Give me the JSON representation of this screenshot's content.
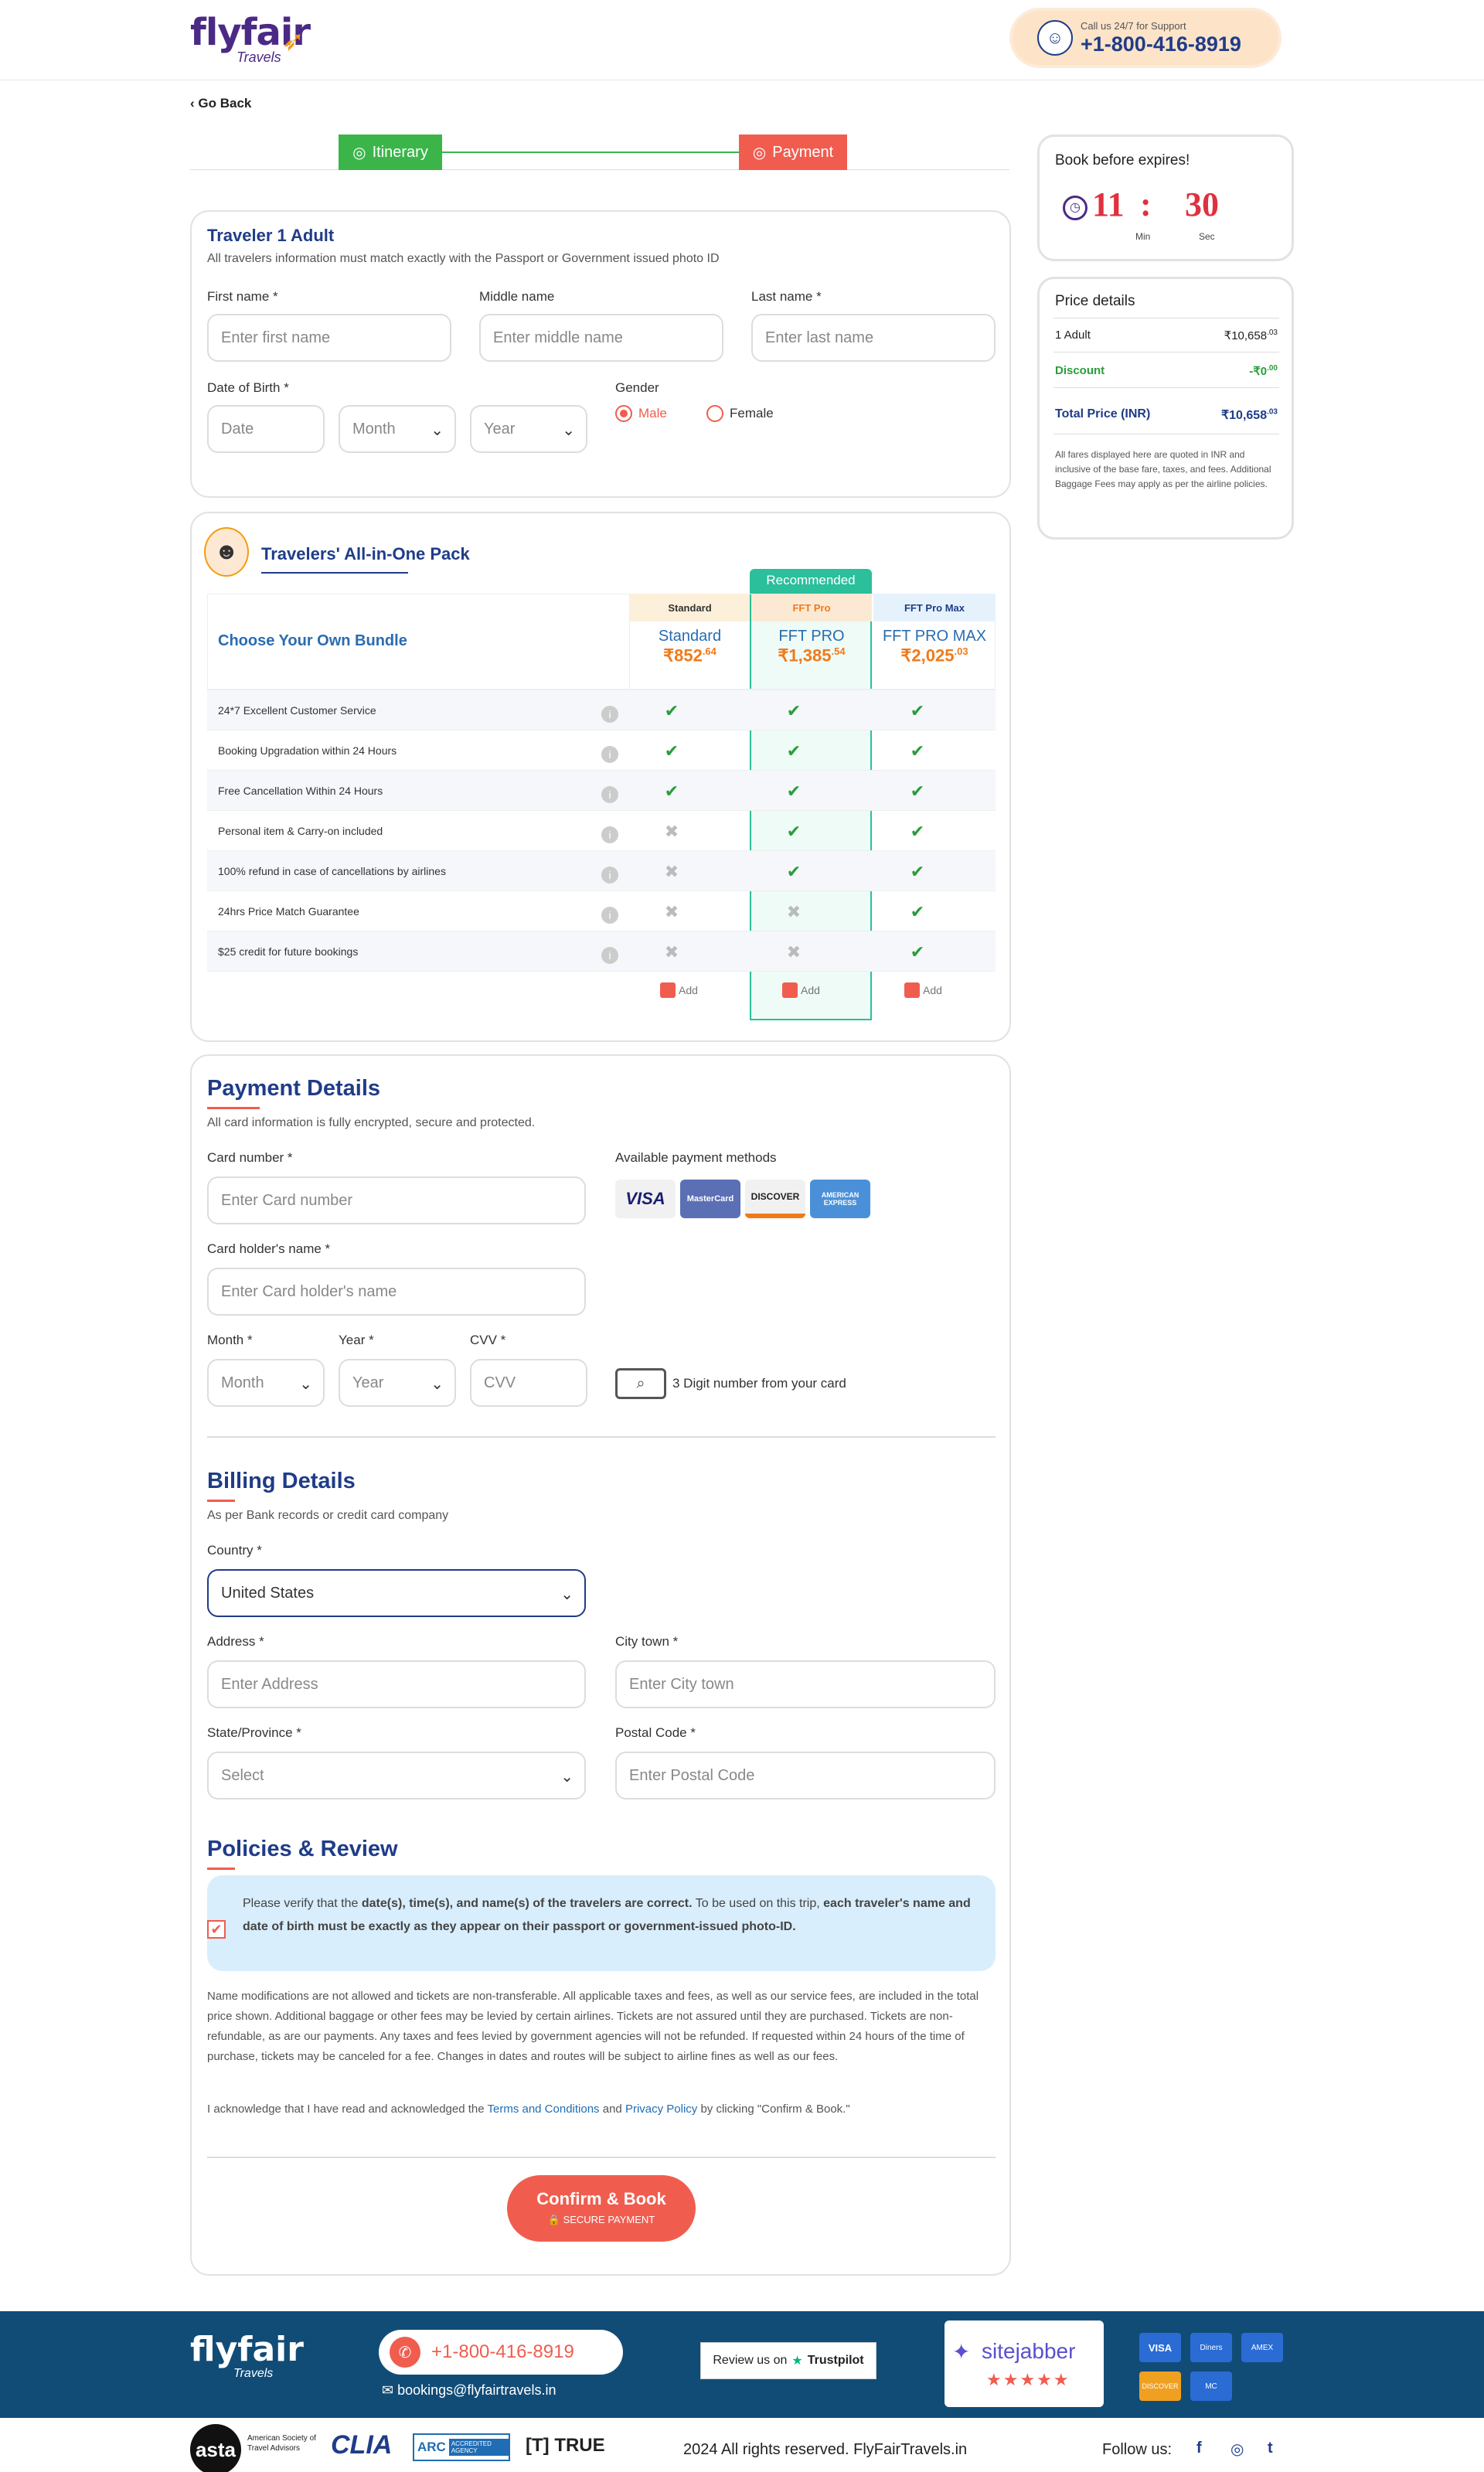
{
  "header": {
    "logo_main": "flyfair",
    "logo_sub": "Travels",
    "support_label": "Call us 24/7 for Support",
    "support_phone": "+1-800-416-8919"
  },
  "nav": {
    "go_back": "Go Back"
  },
  "steps": {
    "itinerary": "Itinerary",
    "payment": "Payment"
  },
  "traveler": {
    "title": "Traveler 1 Adult",
    "note": "All travelers information must match exactly with the Passport or Government issued photo ID",
    "first_name_label": "First name *",
    "first_name_placeholder": "Enter first name",
    "middle_name_label": "Middle name",
    "middle_name_placeholder": "Enter middle name",
    "last_name_label": "Last name *",
    "last_name_placeholder": "Enter last name",
    "dob_label": "Date of Birth *",
    "dob_date": "Date",
    "dob_month": "Month",
    "dob_year": "Year",
    "gender_label": "Gender",
    "gender_male": "Male",
    "gender_female": "Female",
    "gender_selected": "Male"
  },
  "bundle": {
    "title": "Travelers' All-in-One Pack",
    "choose": "Choose Your Own Bundle",
    "recommended": "Recommended",
    "plans": [
      {
        "badge": "Standard",
        "name": "Standard",
        "price": "₹852",
        "cents": ".64",
        "add": "Add"
      },
      {
        "badge": "FFT Pro",
        "name": "FFT PRO",
        "price": "₹1,385",
        "cents": ".54",
        "add": "Add"
      },
      {
        "badge": "FFT Pro Max",
        "name": "FFT PRO MAX",
        "price": "₹2,025",
        "cents": ".03",
        "add": "Add"
      }
    ],
    "features": [
      {
        "name": "24*7 Excellent Customer Service",
        "marks": [
          true,
          true,
          true
        ]
      },
      {
        "name": "Booking Upgradation within 24 Hours",
        "marks": [
          true,
          true,
          true
        ]
      },
      {
        "name": "Free Cancellation Within 24 Hours",
        "marks": [
          true,
          true,
          true
        ]
      },
      {
        "name": "Personal item & Carry-on included",
        "marks": [
          false,
          true,
          true
        ]
      },
      {
        "name": "100% refund in case of cancellations by airlines",
        "marks": [
          false,
          true,
          true
        ]
      },
      {
        "name": "24hrs Price Match Guarantee",
        "marks": [
          false,
          false,
          true
        ]
      },
      {
        "name": "$25 credit for future bookings",
        "marks": [
          false,
          false,
          true
        ]
      }
    ]
  },
  "payment": {
    "title": "Payment Details",
    "note": "All card information is fully encrypted, secure and protected.",
    "card_number_label": "Card number *",
    "card_number_placeholder": "Enter Card number",
    "methods_label": "Available payment methods",
    "methods": [
      "VISA",
      "MasterCard",
      "DISCOVER",
      "AMERICAN EXPRESS"
    ],
    "holder_label": "Card holder's name *",
    "holder_placeholder": "Enter Card holder's name",
    "month_label": "Month *",
    "month_value": "Month",
    "year_label": "Year *",
    "year_value": "Year",
    "cvv_label": "CVV *",
    "cvv_placeholder": "CVV",
    "cvv_hint": "3 Digit number from your card"
  },
  "billing": {
    "title": "Billing Details",
    "note": "As per Bank records or credit card company",
    "country_label": "Country *",
    "country_value": "United States",
    "address_label": "Address *",
    "address_placeholder": "Enter Address",
    "city_label": "City town *",
    "city_placeholder": "Enter City town",
    "state_label": "State/Province *",
    "state_value": "Select",
    "postal_label": "Postal Code *",
    "postal_placeholder": "Enter Postal Code"
  },
  "policies": {
    "title": "Policies & Review",
    "verify_a": "Please verify that the ",
    "verify_b": "date(s), time(s), and name(s) of the travelers are correct.",
    "verify_c": " To be used on this trip, ",
    "verify_d": "each traveler's name and date of birth must be exactly as they appear on their passport or government-issued photo-ID.",
    "body": "Name modifications are not allowed and tickets are non-transferable. All applicable taxes and fees, as well as our service fees, are included in the total price shown. Additional baggage or other fees may be levied by certain airlines. Tickets are not assured until they are purchased. Tickets are non-refundable, as are our payments. Any taxes and fees levied by government agencies will not be refunded. If requested within 24 hours of the time of purchase, tickets may be canceled for a fee. Changes in dates and routes will be subject to airline fines as well as our fees.",
    "ack_a": "I acknowledge that I have read and acknowledged the ",
    "ack_terms": "Terms and Conditions",
    "ack_and": " and ",
    "ack_privacy": "Privacy Policy",
    "ack_b": " by clicking \"Confirm & Book.\"",
    "confirm": "Confirm & Book",
    "secure": "SECURE PAYMENT"
  },
  "timer": {
    "title": "Book before expires!",
    "min": "11",
    "sep": ":",
    "sec": "30",
    "min_label": "Min",
    "sec_label": "Sec"
  },
  "price": {
    "title": "Price details",
    "adult_label": "1 Adult",
    "adult_value": "₹10,658",
    "adult_cents": ".03",
    "discount_label": "Discount",
    "discount_value": "-₹0",
    "discount_cents": ".00",
    "total_label": "Total Price (INR)",
    "total_value": "₹10,658",
    "total_cents": ".03",
    "note": "All fares displayed here are quoted in INR and inclusive of the base fare, taxes, and fees. Additional Baggage Fees may apply as per the airline policies."
  },
  "footer": {
    "logo_main": "flyfair",
    "logo_sub": "Travels",
    "phone": "+1-800-416-8919",
    "email": "bookings@flyfairtravels.in",
    "review": "Review us on",
    "trustpilot": "Trustpilot",
    "sitejabber": "sitejabber",
    "stars": "★★★★★",
    "cards": [
      "VISA",
      "Diners",
      "AMEX",
      "DISCOVER",
      "MC"
    ],
    "asta": "asta",
    "asta_sub": "American Society of Travel Advisors",
    "clia": "CLIA",
    "arc": "ARC",
    "arc_sub": "ACCREDITED AGENCY",
    "true": "[T] TRUE",
    "copyright": "2024 All rights reserved. FlyFairTravels.in",
    "follow": "Follow us:",
    "social": [
      "f",
      "◎",
      "t"
    ]
  },
  "colors": {
    "primary": "#1f3c88",
    "accent": "#f05d4f",
    "green": "#3bb54a",
    "footer": "#114c77"
  }
}
